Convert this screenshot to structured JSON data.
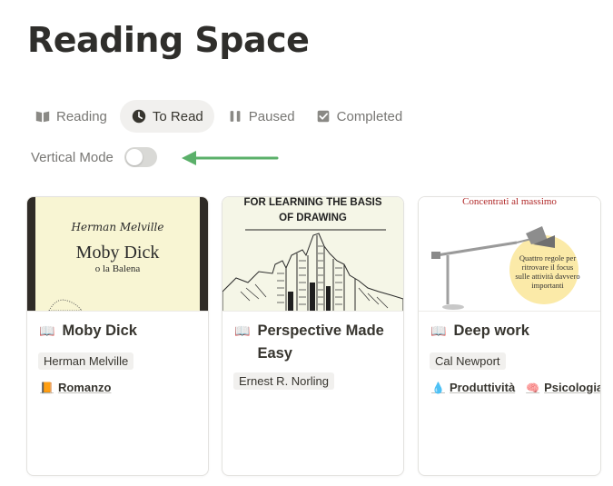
{
  "page": {
    "title": "Reading Space"
  },
  "tabs": [
    {
      "label": "Reading",
      "icon": "open-book-icon"
    },
    {
      "label": "To Read",
      "icon": "clock-icon",
      "active": true
    },
    {
      "label": "Paused",
      "icon": "pause-icon"
    },
    {
      "label": "Completed",
      "icon": "checkbox-icon"
    }
  ],
  "vertical_mode": {
    "label": "Vertical Mode",
    "enabled": false
  },
  "colors": {
    "arrow": "#5bb06a",
    "progress_accent": "#f2a33a"
  },
  "books": [
    {
      "title": "Moby Dick",
      "author": "Herman Melville",
      "genres": [
        {
          "label": "Romanzo",
          "icon": "orange-book-icon"
        }
      ],
      "cover": {
        "author": "Herman Melville",
        "title": "Moby Dick",
        "subtitle": "o la Balena"
      }
    },
    {
      "title": "Perspective Made Easy",
      "author": "Ernest R. Norling",
      "genres": [],
      "cover": {
        "line1": "FOR LEARNING THE BASIS",
        "line2": "OF DRAWING"
      }
    },
    {
      "title": "Deep work",
      "author": "Cal Newport",
      "genres": [
        {
          "label": "Produttività",
          "icon": "droplet-icon"
        },
        {
          "label": "Psicologia",
          "icon": "brain-icon"
        }
      ],
      "cover": {
        "heading": "Concentrati al massimo",
        "note_l1": "Quattro regole per",
        "note_l2": "ritrovare il focus",
        "note_l3": "sulle attività davvero",
        "note_l4": "importanti"
      }
    }
  ]
}
